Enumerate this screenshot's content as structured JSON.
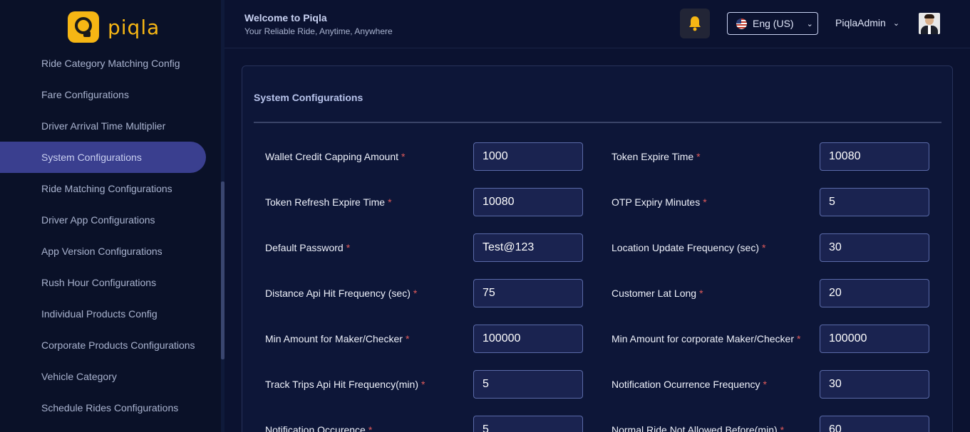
{
  "brand": {
    "name": "piqla",
    "logo_icon": "piqla-logo-icon",
    "accent": "#f6b614"
  },
  "sidebar": {
    "items": [
      {
        "label": "Ride Category Matching Config",
        "active": false
      },
      {
        "label": "Fare Configurations",
        "active": false
      },
      {
        "label": "Driver Arrival Time Multiplier",
        "active": false
      },
      {
        "label": "System Configurations",
        "active": true
      },
      {
        "label": "Ride Matching Configurations",
        "active": false
      },
      {
        "label": "Driver App Configurations",
        "active": false
      },
      {
        "label": "App Version Configurations",
        "active": false
      },
      {
        "label": "Rush Hour Configurations",
        "active": false
      },
      {
        "label": "Individual Products Config",
        "active": false
      },
      {
        "label": "Corporate Products Configurations",
        "active": false
      },
      {
        "label": "Vehicle Category",
        "active": false
      },
      {
        "label": "Schedule Rides Configurations",
        "active": false
      }
    ]
  },
  "header": {
    "title": "Welcome to Piqla",
    "subtitle": "Your Reliable Ride, Anytime, Anywhere",
    "notification_icon": "bell-icon",
    "language": "Eng (US)",
    "username": "PiqlaAdmin"
  },
  "main": {
    "card_title": "System Configurations",
    "required_marker": "*",
    "rows": [
      {
        "left": {
          "label": "Wallet Credit Capping Amount",
          "value": "1000"
        },
        "right": {
          "label": "Token Expire Time",
          "value": "10080"
        }
      },
      {
        "left": {
          "label": "Token Refresh Expire Time",
          "value": "10080"
        },
        "right": {
          "label": "OTP Expiry Minutes",
          "value": "5"
        }
      },
      {
        "left": {
          "label": "Default Password",
          "value": "Test@123"
        },
        "right": {
          "label": "Location Update Frequency (sec)",
          "value": "30"
        }
      },
      {
        "left": {
          "label": "Distance Api Hit Frequency (sec)",
          "value": "75"
        },
        "right": {
          "label": "Customer Lat Long",
          "value": "20"
        }
      },
      {
        "left": {
          "label": "Min Amount for Maker/Checker",
          "value": "100000"
        },
        "right": {
          "label": "Min Amount for corporate Maker/Checker",
          "value": "100000"
        }
      },
      {
        "left": {
          "label": "Track Trips Api Hit Frequency(min)",
          "value": "5"
        },
        "right": {
          "label": "Notification Ocurrence Frequency",
          "value": "30"
        }
      },
      {
        "left": {
          "label": "Notification Occurence",
          "value": "5"
        },
        "right": {
          "label": "Normal Ride Not Allowed Before(min)",
          "value": "60"
        }
      }
    ]
  }
}
